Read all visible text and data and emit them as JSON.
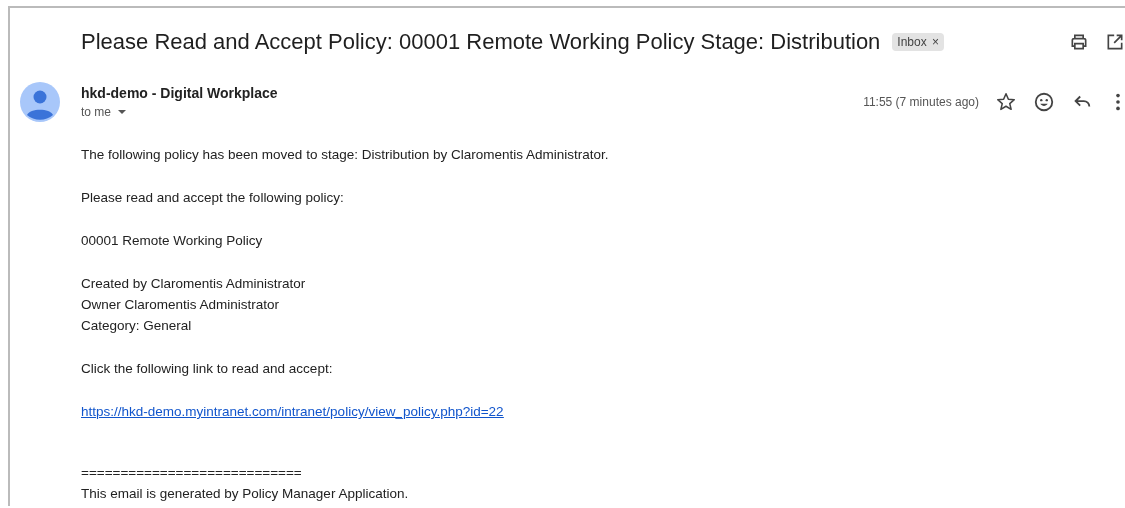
{
  "subject": "Please Read and Accept Policy: 00001 Remote Working Policy Stage: Distribution",
  "label": {
    "text": "Inbox",
    "remove": "×"
  },
  "sender": {
    "name": "hkd-demo - Digital Workplace",
    "recipient": "to me"
  },
  "time": "11:55 (7 minutes ago)",
  "body": [
    {
      "kind": "text",
      "lines": [
        "The following policy has been moved to stage: Distribution by Claromentis Administrator."
      ]
    },
    {
      "kind": "text",
      "lines": [
        "Please read and accept the following policy:"
      ]
    },
    {
      "kind": "text",
      "lines": [
        "00001 Remote Working Policy"
      ]
    },
    {
      "kind": "text",
      "lines": [
        "Created by Claromentis Administrator",
        "Owner Claromentis Administrator",
        "Category: General"
      ]
    },
    {
      "kind": "text",
      "lines": [
        "Click the following link to read and accept:"
      ]
    },
    {
      "kind": "link",
      "lines": [
        "https://hkd-demo.myintranet.com/intranet/policy/view_policy.php?id=22"
      ]
    },
    {
      "kind": "footer",
      "lines": [
        "============================",
        "This email is generated by Policy Manager Application."
      ]
    }
  ]
}
